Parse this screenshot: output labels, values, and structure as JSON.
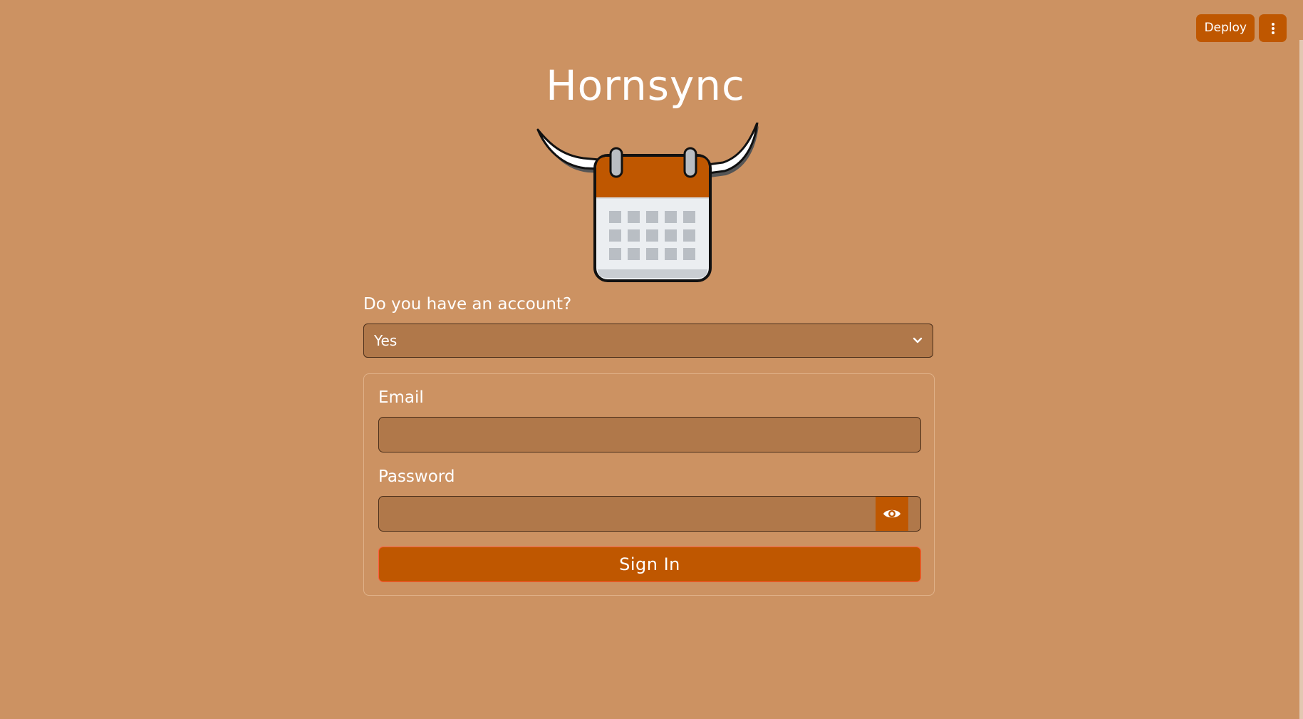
{
  "toolbar": {
    "deploy_label": "Deploy",
    "menu_icon": "vertical-dots-icon"
  },
  "app": {
    "title": "Hornsync",
    "logo": "horned-calendar-logo"
  },
  "account": {
    "question": "Do you have an account?",
    "selected": "Yes",
    "dropdown_icon": "chevron-down-icon"
  },
  "form": {
    "email_label": "Email",
    "email_value": "",
    "password_label": "Password",
    "password_value": "",
    "reveal_icon": "eye-icon",
    "submit_label": "Sign In"
  },
  "colors": {
    "background": "#cc9262",
    "accent": "#bf5700",
    "field": "#b0784a"
  }
}
